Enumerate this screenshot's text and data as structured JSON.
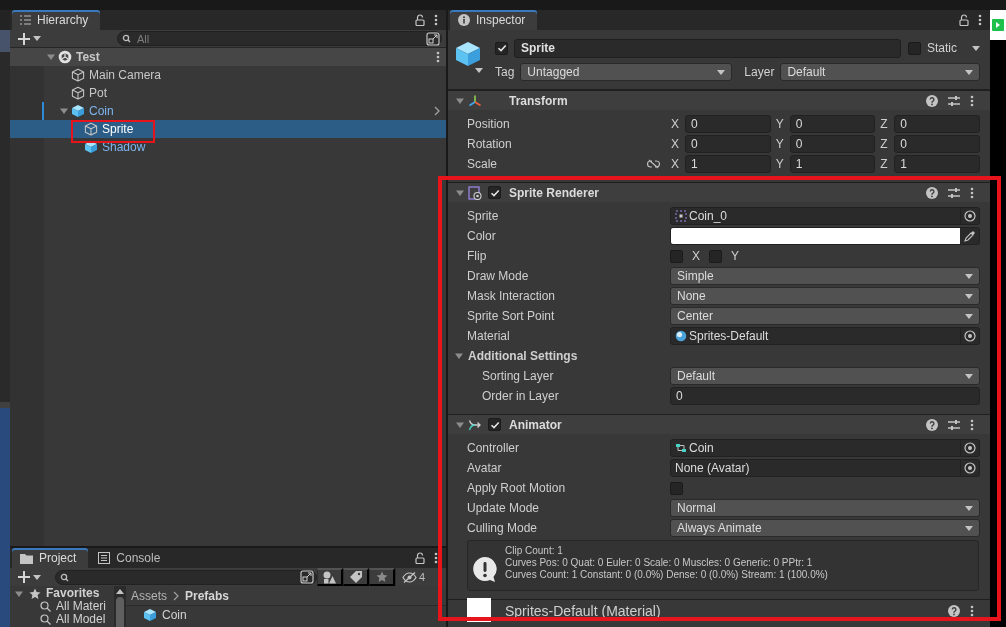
{
  "hierarchy": {
    "tab": {
      "label": "Hierarchy",
      "selected": true
    },
    "search": {
      "placeholder": "All"
    },
    "tree": [
      {
        "label": "Test",
        "kind": "scene",
        "expanded": true,
        "selected": false,
        "children": [
          {
            "label": "Main Camera",
            "kind": "object",
            "selected": false
          },
          {
            "label": "Pot",
            "kind": "object",
            "selected": false
          },
          {
            "label": "Coin",
            "kind": "prefab",
            "expanded": true,
            "selected": false,
            "children": [
              {
                "label": "Sprite",
                "kind": "object",
                "selected": true
              },
              {
                "label": "Shadow",
                "kind": "prefab",
                "selected": false
              }
            ]
          }
        ]
      }
    ]
  },
  "project": {
    "tabs": [
      {
        "label": "Project",
        "kind": "project",
        "selected": true
      },
      {
        "label": "Console",
        "kind": "console",
        "selected": false
      }
    ],
    "hidden_count": "4",
    "favorites": {
      "label": "Favorites",
      "expanded": true,
      "children": [
        {
          "label": "All Materi"
        },
        {
          "label": "All Model"
        }
      ]
    },
    "breadcrumb": [
      "Assets",
      "Prefabs"
    ],
    "assets": [
      {
        "label": "Coin",
        "kind": "prefab"
      }
    ]
  },
  "inspector": {
    "tab": {
      "label": "Inspector",
      "selected": true
    },
    "object": {
      "active": true,
      "name": "Sprite",
      "static": false,
      "static_label": "Static",
      "tag_label": "Tag",
      "tag": "Untagged",
      "layer_label": "Layer",
      "layer": "Default"
    },
    "components": [
      {
        "kind": "transform",
        "title": "Transform",
        "expanded": true,
        "rows": [
          {
            "kind": "vector",
            "label": "Position",
            "values": [
              {
                "axis": "X",
                "value": "0"
              },
              {
                "axis": "Y",
                "value": "0"
              },
              {
                "axis": "Z",
                "value": "0"
              }
            ]
          },
          {
            "kind": "vector",
            "label": "Rotation",
            "values": [
              {
                "axis": "X",
                "value": "0"
              },
              {
                "axis": "Y",
                "value": "0"
              },
              {
                "axis": "Z",
                "value": "0"
              }
            ]
          },
          {
            "kind": "scale",
            "label": "Scale",
            "values": [
              {
                "axis": "X",
                "value": "1"
              },
              {
                "axis": "Y",
                "value": "1"
              },
              {
                "axis": "Z",
                "value": "1"
              }
            ]
          }
        ]
      },
      {
        "kind": "sprite_renderer",
        "title": "Sprite Renderer",
        "expanded": true,
        "enabled": true,
        "rows": [
          {
            "kind": "object",
            "label": "Sprite",
            "value": "Coin_0",
            "asset": {
              "kind": "sprite"
            }
          },
          {
            "kind": "color",
            "label": "Color",
            "color": "#ffffff"
          },
          {
            "kind": "toggles",
            "label": "Flip",
            "toggles": [
              {
                "label": "X",
                "checked": false
              },
              {
                "label": "Y",
                "checked": false
              }
            ]
          },
          {
            "kind": "dropdown",
            "label": "Draw Mode",
            "value": "Simple"
          },
          {
            "kind": "dropdown",
            "label": "Mask Interaction",
            "value": "None"
          },
          {
            "kind": "dropdown",
            "label": "Sprite Sort Point",
            "value": "Center"
          },
          {
            "kind": "object",
            "label": "Material",
            "value": "Sprites-Default",
            "asset": {
              "kind": "material"
            }
          },
          {
            "kind": "foldout",
            "label": "Additional Settings",
            "expanded": true,
            "children": [
              {
                "kind": "dropdown",
                "label": "Sorting Layer",
                "value": "Default"
              },
              {
                "kind": "number",
                "label": "Order in Layer",
                "value": "0"
              }
            ]
          }
        ]
      },
      {
        "kind": "animator",
        "title": "Animator",
        "expanded": true,
        "enabled": true,
        "rows": [
          {
            "kind": "object",
            "label": "Controller",
            "value": "Coin",
            "asset": {
              "kind": "controller"
            }
          },
          {
            "kind": "object",
            "label": "Avatar",
            "value": "None (Avatar)"
          },
          {
            "kind": "checkbox",
            "label": "Apply Root Motion",
            "checked": false
          },
          {
            "kind": "dropdown",
            "label": "Update Mode",
            "value": "Normal"
          },
          {
            "kind": "dropdown",
            "label": "Culling Mode",
            "value": "Always Animate"
          },
          {
            "kind": "info",
            "lines": [
              "Clip Count: 1",
              "Curves Pos: 0 Quat: 0 Euler: 0 Scale: 0 Muscles: 0 Generic: 0 PPtr: 1",
              "Curves Count: 1 Constant: 0 (0.0%) Dense: 0 (0.0%) Stream: 1 (100.0%)"
            ]
          }
        ]
      },
      {
        "kind": "material",
        "title": "Sprites-Default (Material)"
      }
    ]
  }
}
